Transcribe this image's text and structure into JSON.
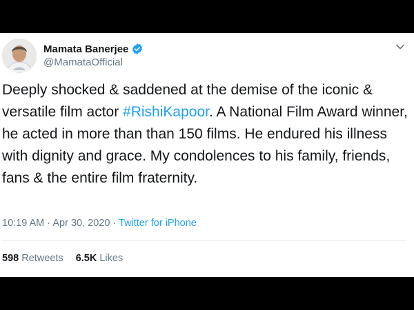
{
  "user": {
    "name": "Mamata Banerjee",
    "handle": "@MamataOfficial",
    "verified": true
  },
  "tweet": {
    "text_before": "Deeply shocked & saddened at the demise of the iconic & versatile film actor ",
    "hashtag": "#RishiKapoor",
    "text_after": ". A National Film Award winner, he acted in more than than 150 films. He endured his illness with dignity and grace. My condolences to his family, friends, fans & the entire film fraternity."
  },
  "meta": {
    "time": "10:19 AM",
    "separator": " · ",
    "date": "Apr 30, 2020",
    "source": "Twitter for iPhone"
  },
  "stats": {
    "retweets_count": "598",
    "retweets_label": "Retweets",
    "likes_count": "6.5K",
    "likes_label": "Likes"
  },
  "colors": {
    "accent": "#1da1f2",
    "text": "#14171a",
    "muted": "#657786",
    "frame": "#000000"
  },
  "icons": [
    "verified-badge-icon",
    "chevron-down-icon"
  ]
}
